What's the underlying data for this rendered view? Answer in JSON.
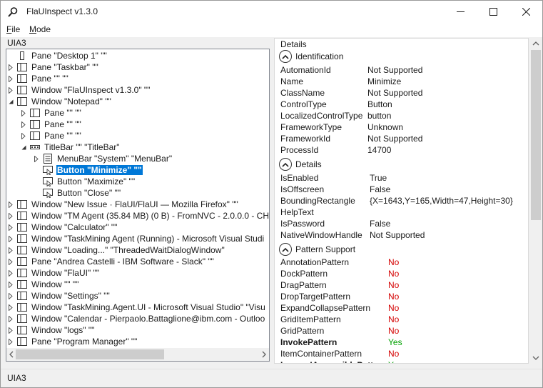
{
  "window": {
    "title": "FlaUInspect v1.3.0",
    "icon": "magnifier-icon"
  },
  "menu": {
    "file": {
      "accel": "F",
      "rest": "ile"
    },
    "mode": {
      "accel": "M",
      "rest": "ode"
    }
  },
  "left": {
    "header": "UIA3"
  },
  "tree": [
    {
      "label": "Pane \"Desktop 1\" \"\"",
      "icon": "desktop-icon",
      "expander": "none"
    },
    {
      "label": "Pane \"Taskbar\" \"\"",
      "icon": "pane-icon",
      "expander": "collapsed"
    },
    {
      "label": "Pane \"\" \"\"",
      "icon": "pane-icon",
      "expander": "collapsed"
    },
    {
      "label": "Window \"FlaUInspect v1.3.0\" \"\"",
      "icon": "window-icon",
      "expander": "collapsed"
    },
    {
      "label": "Window \"Notepad\" \"\"",
      "icon": "window-icon",
      "expander": "expanded"
    },
    {
      "label": "Pane \"\" \"\"",
      "icon": "pane-icon",
      "expander": "collapsed"
    },
    {
      "label": "Pane \"\" \"\"",
      "icon": "pane-icon",
      "expander": "collapsed"
    },
    {
      "label": "Pane \"\" \"\"",
      "icon": "pane-icon",
      "expander": "collapsed"
    },
    {
      "label": "TitleBar \"\" \"TitleBar\"",
      "icon": "titlebar-icon",
      "expander": "expanded"
    },
    {
      "label": "MenuBar \"System\" \"MenuBar\"",
      "icon": "menubar-icon",
      "expander": "collapsed"
    },
    {
      "label": "Button \"Minimize\" \"\"",
      "icon": "button-icon",
      "expander": "none",
      "selected": true
    },
    {
      "label": "Button \"Maximize\" \"\"",
      "icon": "button-icon",
      "expander": "none"
    },
    {
      "label": "Button \"Close\" \"\"",
      "icon": "button-icon",
      "expander": "none"
    },
    {
      "label": "Window \"New Issue · FlaUI/FlaUI — Mozilla Firefox\" \"\"",
      "icon": "window-icon",
      "expander": "collapsed"
    },
    {
      "label": "Window \"TM Agent (35.84 MB) (0 B) - FromNVC - 2.0.0.0 - CH[",
      "icon": "window-icon",
      "expander": "collapsed"
    },
    {
      "label": "Window \"Calculator\" \"\"",
      "icon": "window-icon",
      "expander": "collapsed"
    },
    {
      "label": "Window \"TaskMining Agent (Running) - Microsoft Visual Studi",
      "icon": "window-icon",
      "expander": "collapsed"
    },
    {
      "label": "Window \"Loading...\" \"ThreadedWaitDialogWindow\"",
      "icon": "window-icon",
      "expander": "collapsed"
    },
    {
      "label": "Pane \"Andrea Castelli - IBM Software - Slack\" \"\"",
      "icon": "pane-icon",
      "expander": "collapsed"
    },
    {
      "label": "Window \"FlaUI\" \"\"",
      "icon": "window-icon",
      "expander": "collapsed"
    },
    {
      "label": "Window \"\" \"\"",
      "icon": "window-icon",
      "expander": "collapsed"
    },
    {
      "label": "Window \"Settings\" \"\"",
      "icon": "window-icon",
      "expander": "collapsed"
    },
    {
      "label": "Window \"TaskMining.Agent.UI - Microsoft Visual Studio\" \"Visu",
      "icon": "window-icon",
      "expander": "collapsed"
    },
    {
      "label": "Window \"Calendar - Pierpaolo.Battaglione@ibm.com - Outloo",
      "icon": "window-icon",
      "expander": "collapsed"
    },
    {
      "label": "Window \"logs\" \"\"",
      "icon": "window-icon",
      "expander": "collapsed"
    },
    {
      "label": "Pane \"Program Manager\" \"\"",
      "icon": "pane-icon",
      "expander": "collapsed"
    }
  ],
  "details": {
    "title": "Details",
    "identification": {
      "header": "Identification",
      "rows": [
        {
          "name": "AutomationId",
          "value": "Not Supported"
        },
        {
          "name": "Name",
          "value": "Minimize"
        },
        {
          "name": "ClassName",
          "value": "Not Supported"
        },
        {
          "name": "ControlType",
          "value": "Button"
        },
        {
          "name": "LocalizedControlType",
          "value": "button"
        },
        {
          "name": "FrameworkType",
          "value": "Unknown"
        },
        {
          "name": "FrameworkId",
          "value": "Not Supported"
        },
        {
          "name": "ProcessId",
          "value": "14700"
        }
      ]
    },
    "details_group": {
      "header": "Details",
      "rows": [
        {
          "name": "IsEnabled",
          "value": "True"
        },
        {
          "name": "IsOffscreen",
          "value": "False"
        },
        {
          "name": "BoundingRectangle",
          "value": "{X=1643,Y=165,Width=47,Height=30}"
        },
        {
          "name": "HelpText",
          "value": ""
        },
        {
          "name": "IsPassword",
          "value": "False"
        },
        {
          "name": "NativeWindowHandle",
          "value": "Not Supported"
        }
      ]
    },
    "patterns": {
      "header": "Pattern Support",
      "rows": [
        {
          "name": "AnnotationPattern",
          "value": "No"
        },
        {
          "name": "DockPattern",
          "value": "No"
        },
        {
          "name": "DragPattern",
          "value": "No"
        },
        {
          "name": "DropTargetPattern",
          "value": "No"
        },
        {
          "name": "ExpandCollapsePattern",
          "value": "No"
        },
        {
          "name": "GridItemPattern",
          "value": "No"
        },
        {
          "name": "GridPattern",
          "value": "No"
        },
        {
          "name": "InvokePattern",
          "value": "Yes",
          "bold": true
        },
        {
          "name": "ItemContainerPattern",
          "value": "No"
        },
        {
          "name": "LegacyIAccessiblePattern",
          "value": "Yes",
          "bold": true
        }
      ]
    }
  },
  "status": {
    "text": "UIA3"
  },
  "colors": {
    "selection": "#0078d7",
    "no": "#d40000",
    "yes": "#00a000"
  }
}
